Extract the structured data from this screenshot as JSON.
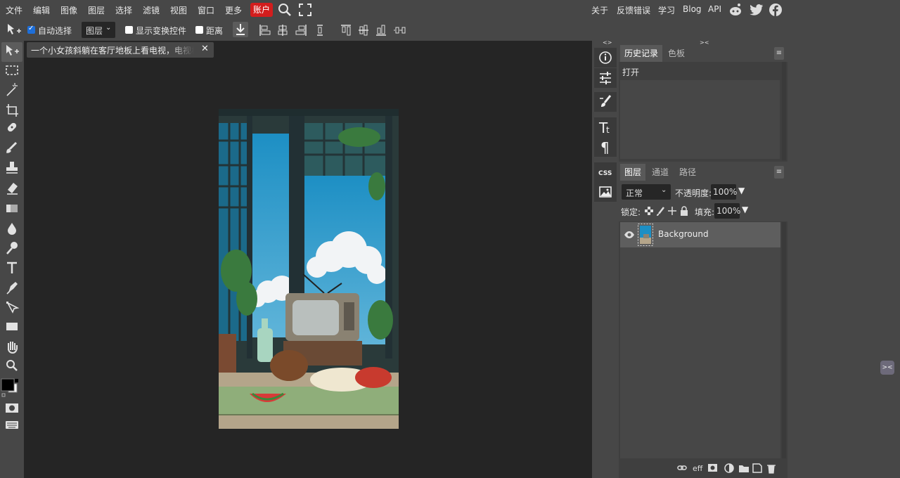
{
  "menu": {
    "items": [
      "文件",
      "编辑",
      "图像",
      "图层",
      "选择",
      "滤镜",
      "视图",
      "窗口",
      "更多"
    ],
    "account": "账户",
    "right_links": [
      "关于",
      "反馈错误",
      "学习",
      "Blog",
      "API"
    ]
  },
  "options": {
    "auto_select_label": "自动选择",
    "auto_select_checked": true,
    "target_select": "图层",
    "show_transform_label": "显示变换控件",
    "distance_label": "距离"
  },
  "document": {
    "tab_title": "一个小女孩斜躺在客厅地板上看电视，电视机",
    "tab_close": "✕"
  },
  "history_panel": {
    "tabs": [
      "历史记录",
      "色板"
    ],
    "active_tab": "历史记录",
    "items": [
      "打开"
    ]
  },
  "layers_panel": {
    "tabs": [
      "图层",
      "通道",
      "路径"
    ],
    "active_tab": "图层",
    "blend_mode": "正常",
    "opacity_label": "不透明度:",
    "opacity_value": "100%",
    "lock_label": "锁定:",
    "fill_label": "填充:",
    "fill_value": "100%",
    "layers": [
      {
        "name": "Background",
        "visible": true
      }
    ],
    "footer_eff": "eff"
  },
  "colors": {
    "accent": "#d31d1d",
    "workspace_bg": "#252525",
    "ui_bg": "#474747",
    "panel_bg": "#3f3f3f",
    "checkbox_blue": "#1e6fd9",
    "foreground": "#000000",
    "background": "#ffffff"
  },
  "icons": {
    "left_tools": [
      "move-tool-icon",
      "marquee-icon",
      "magic-wand-icon",
      "crop-icon",
      "healing-icon",
      "brush-icon",
      "stamp-icon",
      "eraser-icon",
      "gradient-icon",
      "blur-icon",
      "dodge-icon",
      "type-icon",
      "pen-icon",
      "path-select-icon",
      "shape-icon",
      "hand-icon",
      "zoom-icon"
    ]
  }
}
